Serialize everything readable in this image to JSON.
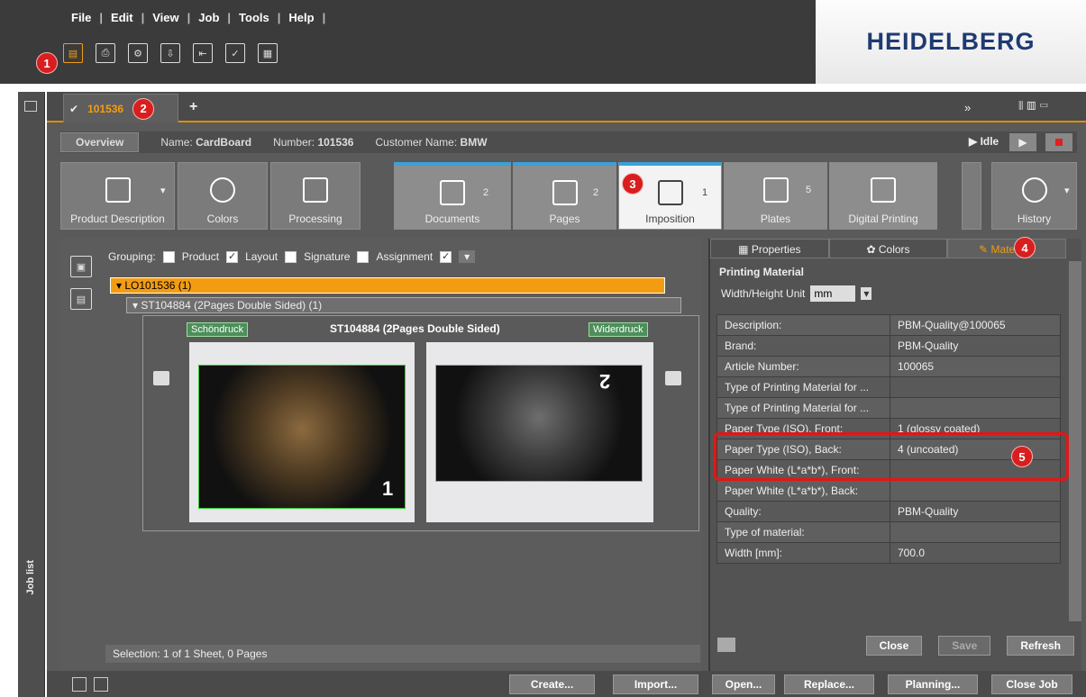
{
  "menu": [
    "File",
    "Edit",
    "View",
    "Job",
    "Tools",
    "Help"
  ],
  "logo": "HEIDELBERG",
  "job_tab": {
    "number": "101536",
    "add": "+"
  },
  "info": {
    "overview": "Overview",
    "name_label": "Name:",
    "name": "CardBoard",
    "number_label": "Number:",
    "number": "101536",
    "customer_label": "Customer Name:",
    "customer": "BMW",
    "status": "Idle"
  },
  "workflow": [
    {
      "label": "Product Description",
      "count": ""
    },
    {
      "label": "Colors",
      "count": ""
    },
    {
      "label": "Processing",
      "count": ""
    },
    {
      "label": "Documents",
      "count": "2"
    },
    {
      "label": "Pages",
      "count": "2"
    },
    {
      "label": "Imposition",
      "count": "1"
    },
    {
      "label": "Plates",
      "count": "5"
    },
    {
      "label": "Digital Printing",
      "count": ""
    },
    {
      "label": "History",
      "count": ""
    }
  ],
  "grouping": {
    "label": "Grouping:",
    "product": "Product",
    "layout": "Layout",
    "signature": "Signature",
    "assignment": "Assignment"
  },
  "tree": {
    "layout": "LO101536 (1)",
    "sheet": "ST104884 (2Pages Double Sided) (1)"
  },
  "sheet": {
    "front": "Schöndruck",
    "title": "ST104884 (2Pages Double Sided)",
    "back": "Widerdruck",
    "page_front": "1",
    "page_back": "2"
  },
  "selection": "Selection:  1 of 1 Sheet,  0 Pages",
  "right_tabs": [
    "Properties",
    "Colors",
    "Materials"
  ],
  "printing_material": {
    "title": "Printing Material",
    "unit_label": "Width/Height Unit",
    "unit": "mm"
  },
  "properties": [
    [
      "Description:",
      "PBM-Quality@100065"
    ],
    [
      "Brand:",
      "PBM-Quality"
    ],
    [
      "Article Number:",
      "100065"
    ],
    [
      "Type of Printing Material for ...",
      ""
    ],
    [
      "Type of Printing Material for ...",
      ""
    ],
    [
      "Paper Type (ISO), Front:",
      "1 (glossy coated)"
    ],
    [
      "Paper Type (ISO), Back:",
      "4 (uncoated)"
    ],
    [
      "Paper White (L*a*b*), Front:",
      ""
    ],
    [
      "Paper White (L*a*b*), Back:",
      ""
    ],
    [
      "Quality:",
      "PBM-Quality"
    ],
    [
      "Type of material:",
      ""
    ],
    [
      "Width [mm]:",
      "700.0"
    ]
  ],
  "panel_buttons": {
    "close": "Close",
    "save": "Save",
    "refresh": "Refresh"
  },
  "bottom_buttons": {
    "create": "Create...",
    "import": "Import...",
    "open": "Open...",
    "replace": "Replace...",
    "planning": "Planning...",
    "close_job": "Close Job"
  },
  "sidebar": {
    "job_list": "Job list"
  },
  "badges": [
    "1",
    "2",
    "3",
    "4",
    "5"
  ]
}
